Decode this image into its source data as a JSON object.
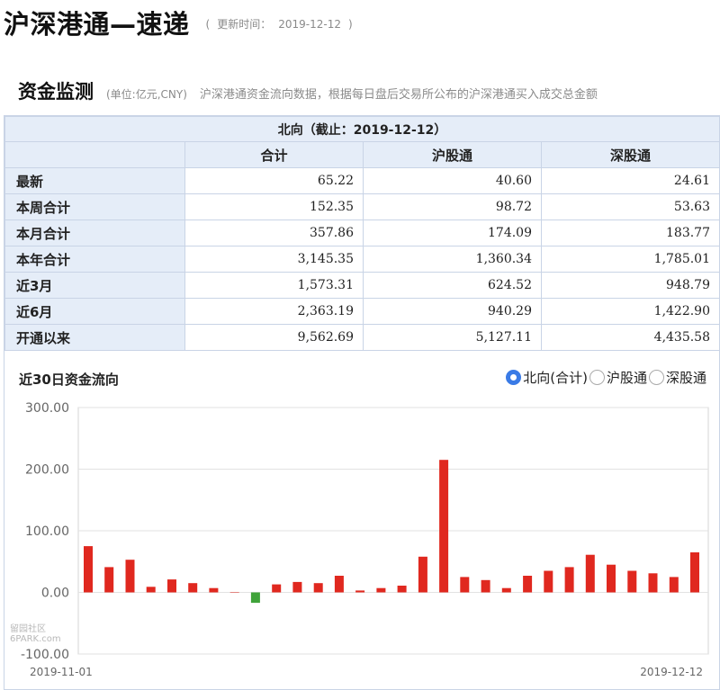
{
  "header": {
    "title": "沪深港通—速递",
    "update_label": "更新时间：",
    "update_date": "2019-12-12"
  },
  "monitor": {
    "title": "资金监测",
    "unit": "(单位:亿元,CNY)",
    "description": "沪深港通资金流向数据，根据每日盘后交易所公布的沪深港通买入成交总金额"
  },
  "table": {
    "caption": "北向（截止：2019-12-12）",
    "columns": [
      "合计",
      "沪股通",
      "深股通"
    ],
    "rows": [
      {
        "label": "最新",
        "values": [
          "65.22",
          "40.60",
          "24.61"
        ]
      },
      {
        "label": "本周合计",
        "values": [
          "152.35",
          "98.72",
          "53.63"
        ]
      },
      {
        "label": "本月合计",
        "values": [
          "357.86",
          "174.09",
          "183.77"
        ]
      },
      {
        "label": "本年合计",
        "values": [
          "3,145.35",
          "1,360.34",
          "1,785.01"
        ]
      },
      {
        "label": "近3月",
        "values": [
          "1,573.31",
          "624.52",
          "948.79"
        ]
      },
      {
        "label": "近6月",
        "values": [
          "2,363.19",
          "940.29",
          "1,422.90"
        ]
      },
      {
        "label": "开通以来",
        "values": [
          "9,562.69",
          "5,127.11",
          "4,435.58"
        ]
      }
    ]
  },
  "chart_section": {
    "title": "近30日资金流向",
    "options": [
      {
        "label": "北向(合计)",
        "checked": true
      },
      {
        "label": "沪股通",
        "checked": false
      },
      {
        "label": "深股通",
        "checked": false
      }
    ]
  },
  "watermark": "留园社区",
  "watermark_sub": "6PARK.com",
  "chart_data": {
    "type": "bar",
    "title": "近30日资金流向",
    "x_start_label": "2019-11-01",
    "x_end_label": "2019-12-12",
    "ylim": [
      -100,
      300
    ],
    "yticks": [
      "300.00",
      "200.00",
      "100.00",
      "0.00",
      "-100.00"
    ],
    "grid": true,
    "positive_color": "#e0281f",
    "negative_color": "#3fa33a",
    "values": [
      75,
      41,
      53,
      9,
      21,
      15,
      7,
      0,
      -17,
      13,
      17,
      15,
      27,
      3,
      7,
      11,
      58,
      215,
      25,
      20,
      7,
      27,
      35,
      41,
      61,
      45,
      35,
      31,
      25,
      65
    ]
  }
}
